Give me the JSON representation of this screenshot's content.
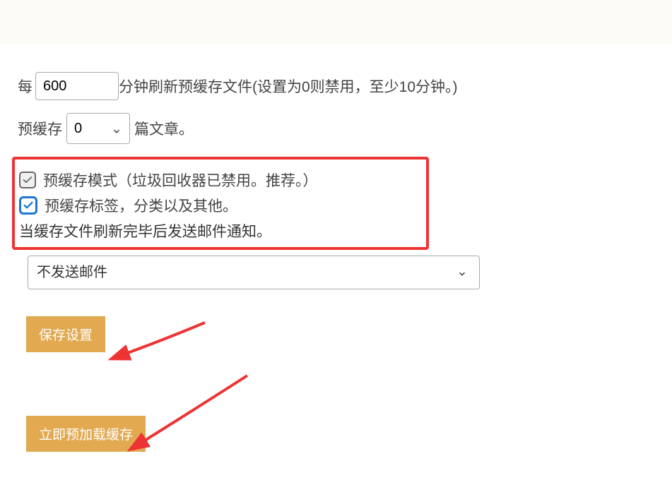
{
  "row1": {
    "prefix": "每",
    "input_value": "600",
    "suffix": "分钟刷新预缓存文件(设置为0则禁用，至少10分钟。)"
  },
  "row2": {
    "prefix": "预缓存",
    "select_value": "0",
    "suffix": "篇文章。"
  },
  "box": {
    "check1_label": "预缓存模式（垃圾回收器已禁用。推荐。）",
    "check2_label": "预缓存标签，分类以及其他。",
    "note": "当缓存文件刷新完毕后发送邮件通知。"
  },
  "email_select": {
    "value": "不发送邮件"
  },
  "buttons": {
    "save": "保存设置",
    "preload": "立即预加载缓存"
  },
  "colors": {
    "accent": "#e2a951",
    "highlight_border": "#e33",
    "checkbox_blue": "#1976d2"
  }
}
